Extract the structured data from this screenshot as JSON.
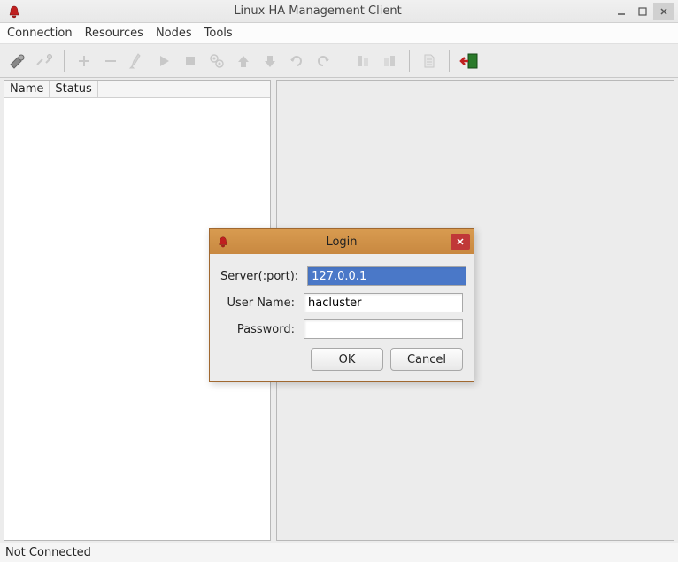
{
  "window": {
    "title": "Linux HA Management Client"
  },
  "menu": {
    "connection": "Connection",
    "resources": "Resources",
    "nodes": "Nodes",
    "tools": "Tools"
  },
  "toolbar_icons": {
    "connect": "connect-icon",
    "disconnect": "disconnect-icon",
    "add": "plus-icon",
    "remove": "minus-icon",
    "cleanup": "broom-icon",
    "start": "play-icon",
    "stop": "stop-icon",
    "manage": "gear-icon",
    "up": "arrow-up-icon",
    "down": "arrow-down-icon",
    "redo": "redo-icon",
    "undo": "undo-icon",
    "group1": "flag1-icon",
    "group2": "flag2-icon",
    "document": "document-icon",
    "exit": "exit-icon"
  },
  "tree": {
    "col_name": "Name",
    "col_status": "Status"
  },
  "statusbar": {
    "text": "Not Connected"
  },
  "login": {
    "title": "Login",
    "server_label": "Server(:port):",
    "server_value": "127.0.0.1",
    "username_label": "User Name:",
    "username_value": "hacluster",
    "password_label": "Password:",
    "password_value": "",
    "ok": "OK",
    "cancel": "Cancel"
  }
}
